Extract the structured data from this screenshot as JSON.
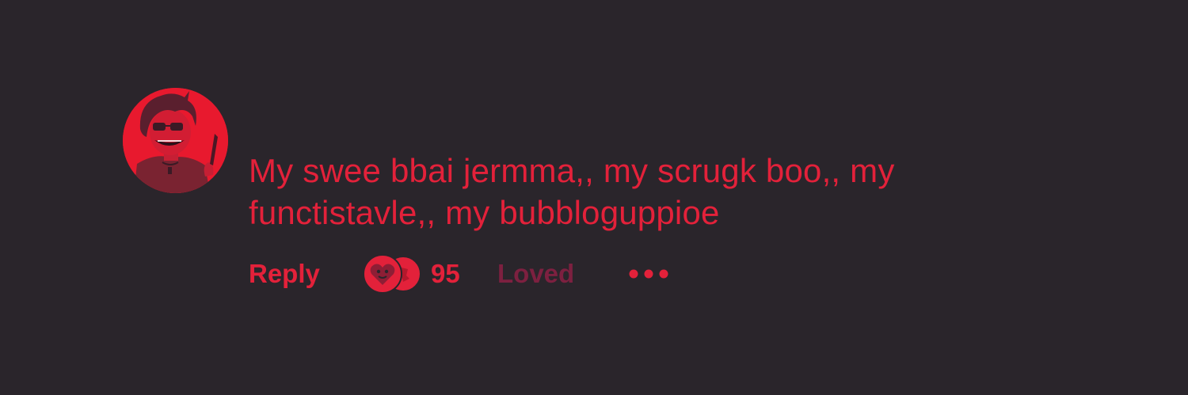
{
  "comment": {
    "text": "My swee bbai jermma,, my scrugk boo,, my functistavle,, my bubbloguppioe",
    "avatar_icon": "user-avatar-icon"
  },
  "actions": {
    "reply_label": "Reply",
    "reaction_count": "95",
    "loved_label": "Loved",
    "reaction_icons": [
      "heart-face-icon",
      "reaction-icon"
    ],
    "more_icon": "more-dots-icon"
  },
  "colors": {
    "background": "#2a252b",
    "accent": "#e3213a",
    "muted_accent": "#7d2040"
  }
}
